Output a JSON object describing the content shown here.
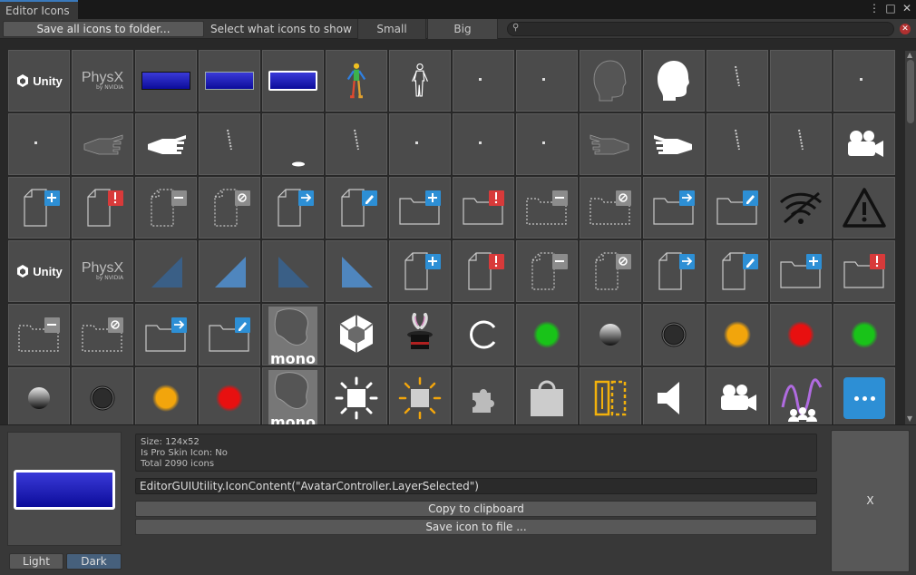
{
  "window": {
    "tab_title": "Editor Icons",
    "controls": [
      "⋮",
      "□",
      "✕"
    ]
  },
  "toolbar": {
    "save_all_label": "Save all icons to folder...",
    "select_label": "Select what icons to show",
    "small_label": "Small",
    "big_label": "Big",
    "search_value": ""
  },
  "grid": {
    "icons": [
      "unity-logo-icon",
      "physx-logo-icon",
      "layer-selected-dark-icon",
      "layer-selected-mid-icon",
      "layer-selected-white-icon",
      "avatar-colored-icon",
      "avatar-body-icon",
      "dot-icon",
      "dot-icon",
      "head-dark-icon",
      "head-white-icon",
      "limb-icon",
      "blank-icon",
      "dot-icon",
      "dot-icon",
      "hand-left-dark-icon",
      "hand-left-white-icon",
      "limb-icon",
      "limb-shadow-icon",
      "limb-icon",
      "dot-icon",
      "dot-icon",
      "dot-icon",
      "hand-right-dark-icon",
      "hand-right-white-icon",
      "limb-icon",
      "limb-icon",
      "camera-icon",
      "file-add-icon",
      "file-error-icon",
      "file-remove-icon",
      "file-blocked-icon",
      "file-move-icon",
      "file-edit-icon",
      "folder-add-icon",
      "folder-error-icon",
      "folder-remove-icon",
      "folder-blocked-icon",
      "folder-move-icon",
      "folder-edit-icon",
      "wifi-off-icon",
      "warning-icon",
      "unity-logo-icon",
      "physx-logo-icon",
      "triangle-dark-icon",
      "triangle-light-icon",
      "triangle-dark-mirror-icon",
      "triangle-light-mirror-icon",
      "file-add-icon",
      "file-error-icon",
      "file-remove-icon",
      "file-blocked-icon",
      "file-move-icon",
      "file-edit-icon",
      "folder-add-icon",
      "folder-error-icon",
      "folder-remove-icon",
      "folder-blocked-icon",
      "folder-move-icon",
      "folder-edit-icon",
      "mono-logo-icon",
      "unity-cube-icon",
      "magic-hat-icon",
      "refresh-icon",
      "green-light-icon",
      "gray-light-icon",
      "empty-light-icon",
      "orange-light-icon",
      "red-light-icon",
      "green-light-icon",
      "gray-light-icon",
      "empty-light-icon",
      "orange-light-icon",
      "red-light-icon",
      "mono-logo-icon",
      "sun-white-icon",
      "sun-yellow-icon",
      "puzzle-icon",
      "shopping-bag-icon",
      "columns-icon",
      "speaker-icon",
      "camera-icon",
      "analytics-icon",
      "more-icon"
    ]
  },
  "details": {
    "size_line": "Size: 124x52",
    "pro_skin_line": "Is Pro Skin Icon: No",
    "total_line": "Total 2090 icons",
    "code_value": "EditorGUIUtility.IconContent(\"AvatarController.LayerSelected\")",
    "copy_label": "Copy to clipboard",
    "save_label": "Save icon to file ...",
    "close_label": "X",
    "light_label": "Light",
    "dark_label": "Dark"
  },
  "logos": {
    "unity_text": "Unity",
    "physx_text": "PhysX",
    "nvidia_text": "by NVIDIA",
    "mono_text": "mono"
  },
  "colors": {
    "accent": "#3a79bb",
    "badge_blue": "#2d8fd5",
    "badge_red": "#d83a3a",
    "badge_gray": "#8c8c8c"
  }
}
